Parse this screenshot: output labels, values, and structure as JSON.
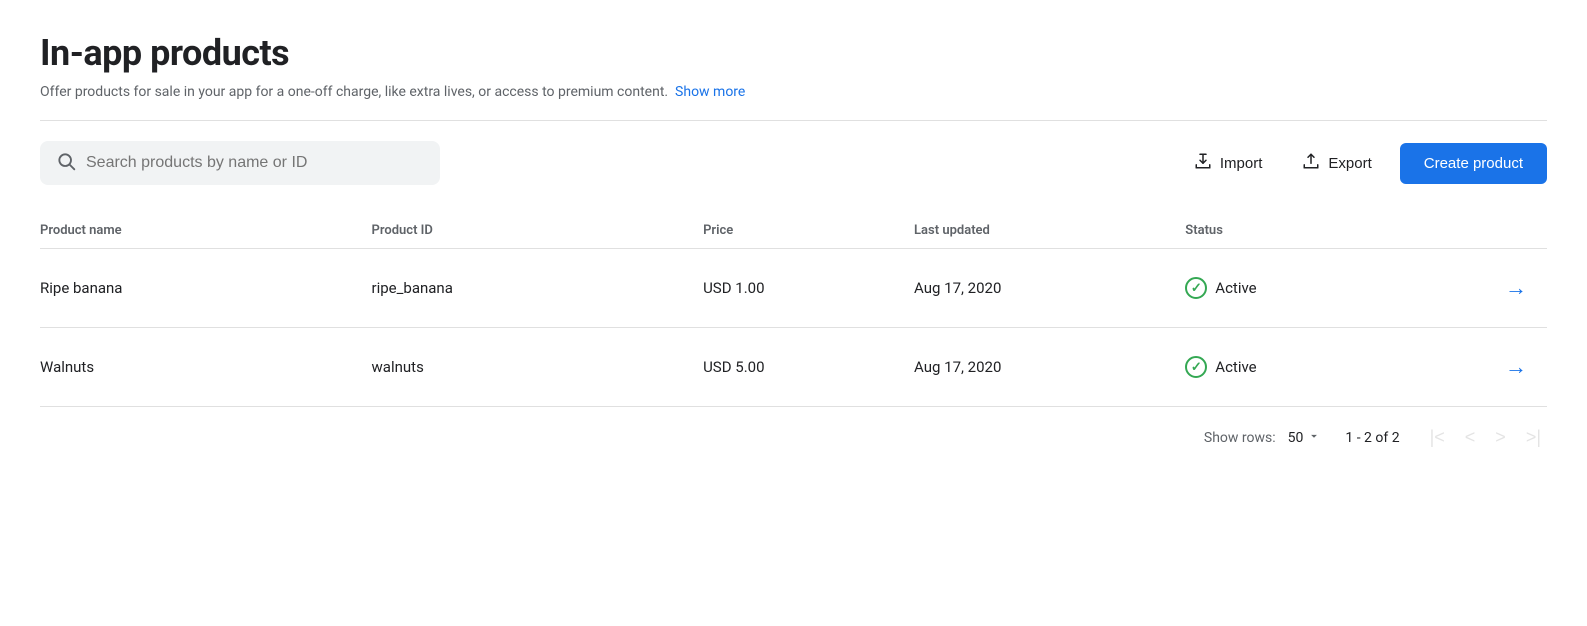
{
  "page": {
    "title": "In-app products",
    "subtitle": "Offer products for sale in your app for a one-off charge, like extra lives, or access to premium content.",
    "show_more_label": "Show more"
  },
  "toolbar": {
    "search_placeholder": "Search products by name or ID",
    "import_label": "Import",
    "export_label": "Export",
    "create_label": "Create product"
  },
  "table": {
    "columns": [
      {
        "key": "name",
        "label": "Product name"
      },
      {
        "key": "id",
        "label": "Product ID"
      },
      {
        "key": "price",
        "label": "Price"
      },
      {
        "key": "updated",
        "label": "Last updated"
      },
      {
        "key": "status",
        "label": "Status"
      }
    ],
    "rows": [
      {
        "name": "Ripe banana",
        "product_id": "ripe_banana",
        "price": "USD 1.00",
        "last_updated": "Aug 17, 2020",
        "status": "Active"
      },
      {
        "name": "Walnuts",
        "product_id": "walnuts",
        "price": "USD 5.00",
        "last_updated": "Aug 17, 2020",
        "status": "Active"
      }
    ]
  },
  "pagination": {
    "rows_label": "Show rows:",
    "rows_value": "50",
    "range": "1 - 2 of 2"
  },
  "colors": {
    "blue": "#1a73e8",
    "green": "#34a853",
    "text_secondary": "#5f6368"
  }
}
